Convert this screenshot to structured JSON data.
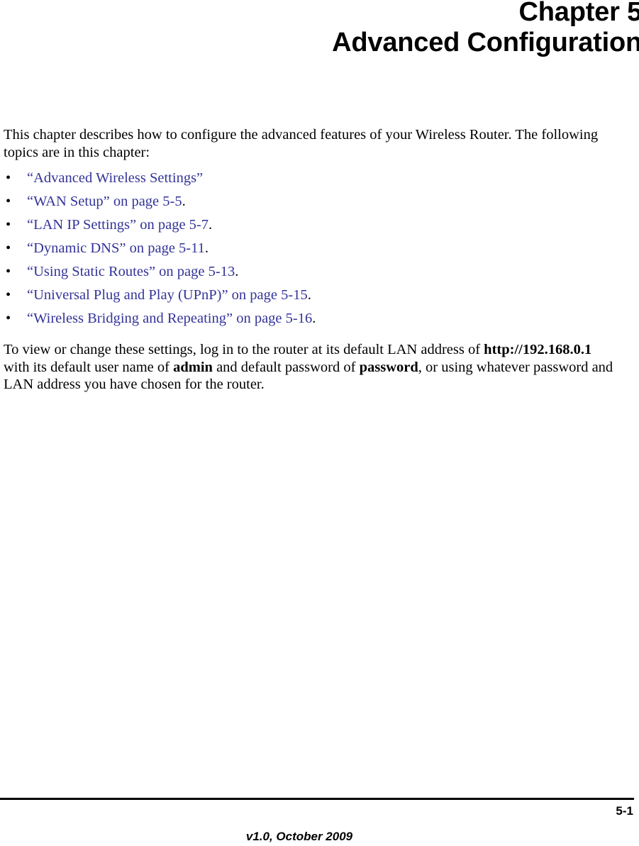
{
  "document": {
    "chapter_number_label": "Chapter 5",
    "chapter_title": "Advanced Configuration",
    "link_color": "#333399",
    "text_color": "#000000"
  },
  "intro_paragraph": "This chapter describes how to configure the advanced features of your Wireless Router. The following topics are in this chapter:",
  "topics": [
    {
      "bullet": "•",
      "link_text": "“Advanced Wireless Settings”",
      "trailing": ""
    },
    {
      "bullet": "•",
      "link_text": "“WAN Setup” on page 5-5",
      "trailing": "."
    },
    {
      "bullet": "•",
      "link_text": "“LAN IP Settings” on page 5-7",
      "trailing": "."
    },
    {
      "bullet": "•",
      "link_text": "“Dynamic DNS” on page 5-11",
      "trailing": "."
    },
    {
      "bullet": "•",
      "link_text": "“Using Static Routes” on page 5-13",
      "trailing": "."
    },
    {
      "bullet": "•",
      "link_text": "“Universal Plug and Play (UPnP)” on page 5-15",
      "trailing": "."
    },
    {
      "bullet": "•",
      "link_text": "“Wireless Bridging and Repeating” on page 5-16",
      "trailing": "."
    }
  ],
  "login_paragraph": {
    "part1": "To view or change these settings, log in to the router at its default LAN address of ",
    "address": "http://192.168.0.1",
    "part2": " with its default user name of ",
    "username": "admin",
    "part3": " and default password of ",
    "password": "password",
    "part4": ", or using whatever password and LAN address you have chosen for the router."
  },
  "footer": {
    "page_number": "5-1",
    "version": "v1.0, October 2009"
  }
}
